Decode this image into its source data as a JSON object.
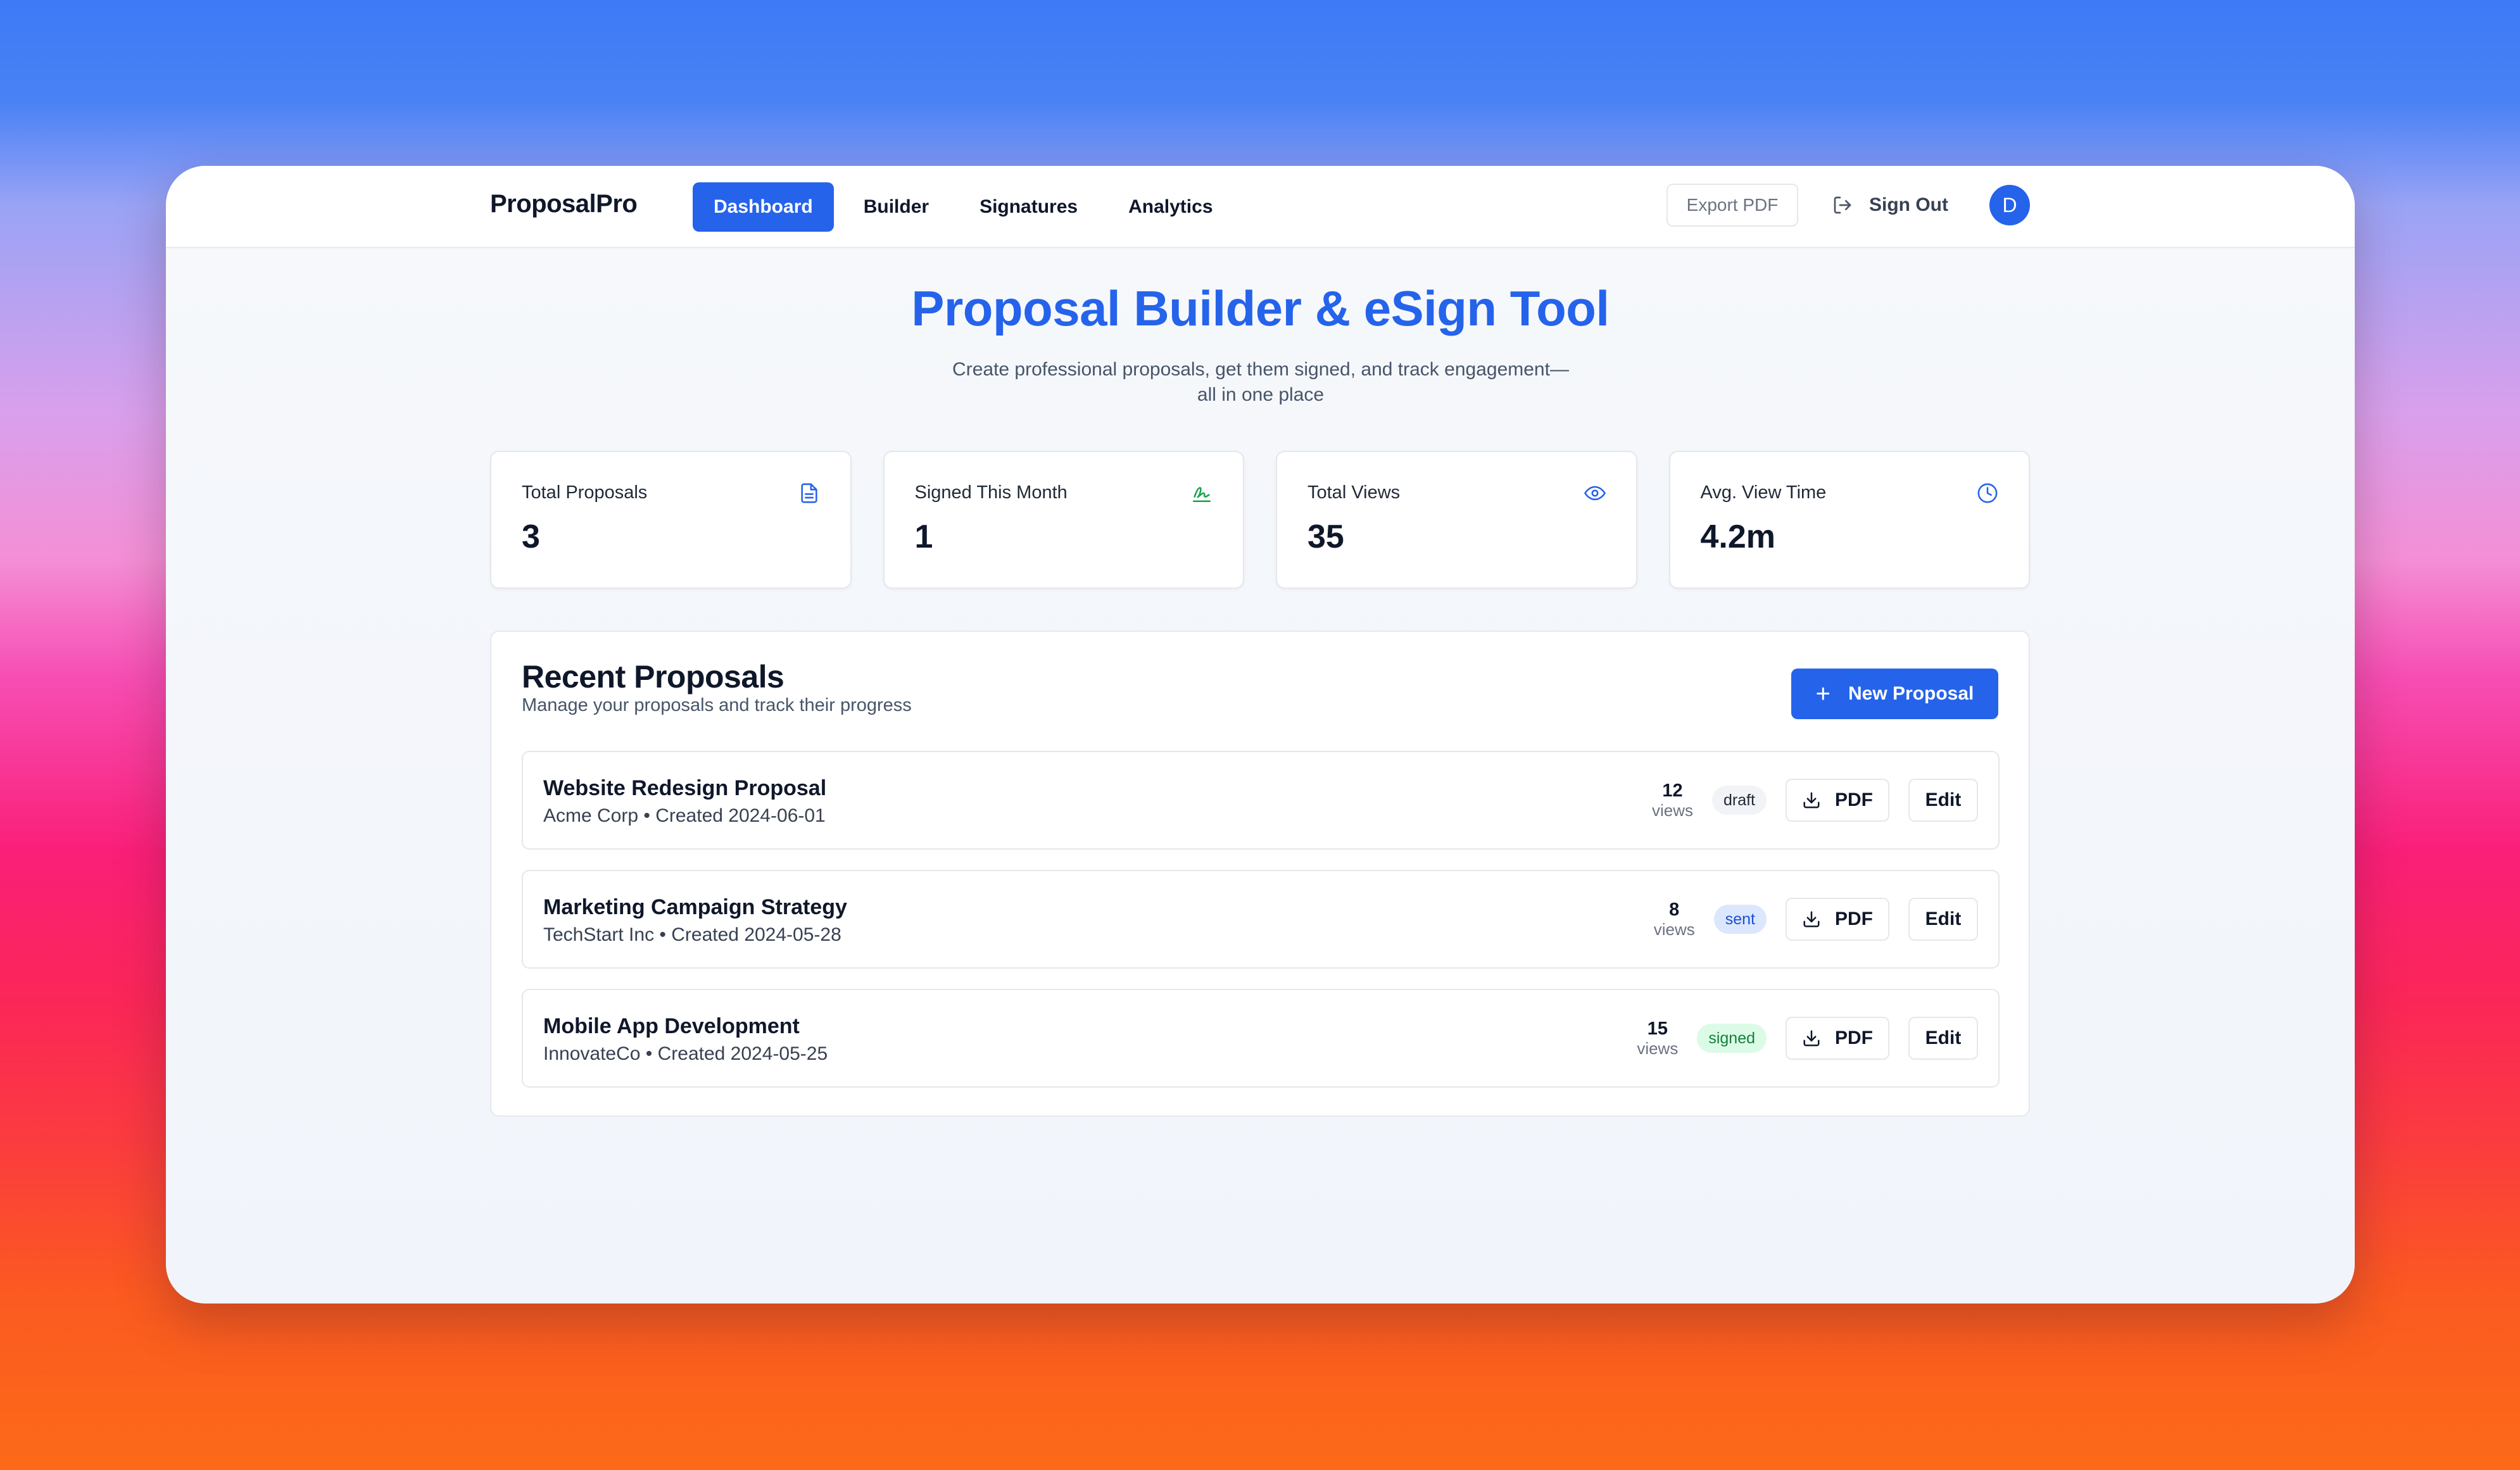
{
  "app": {
    "brand": "ProposalPro"
  },
  "nav": {
    "tabs": [
      {
        "label": "Dashboard",
        "active": true
      },
      {
        "label": "Builder",
        "active": false
      },
      {
        "label": "Signatures",
        "active": false
      },
      {
        "label": "Analytics",
        "active": false
      }
    ]
  },
  "header_actions": {
    "export_label": "Export PDF",
    "signout_label": "Sign Out",
    "signout_icon": "logout-icon",
    "avatar_initial": "D"
  },
  "hero": {
    "title": "Proposal Builder & eSign Tool",
    "subtitle": "Create professional proposals, get them signed, and track engagement—all in one place"
  },
  "stats": [
    {
      "label": "Total Proposals",
      "value": "3",
      "icon": "document-icon",
      "icon_color": "#2563eb"
    },
    {
      "label": "Signed This Month",
      "value": "1",
      "icon": "signature-icon",
      "icon_color": "#16a34a"
    },
    {
      "label": "Total Views",
      "value": "35",
      "icon": "eye-icon",
      "icon_color": "#2563eb"
    },
    {
      "label": "Avg. View Time",
      "value": "4.2m",
      "icon": "clock-icon",
      "icon_color": "#2563eb"
    }
  ],
  "recent": {
    "title": "Recent Proposals",
    "subtitle": "Manage your proposals and track their progress",
    "new_button_label": "New Proposal",
    "views_label": "views",
    "pdf_label": "PDF",
    "edit_label": "Edit",
    "items": [
      {
        "name": "Website Redesign Proposal",
        "meta": "Acme Corp • Created 2024-06-01",
        "views": "12",
        "status": "draft"
      },
      {
        "name": "Marketing Campaign Strategy",
        "meta": "TechStart Inc • Created 2024-05-28",
        "views": "8",
        "status": "sent"
      },
      {
        "name": "Mobile App Development",
        "meta": "InnovateCo • Created 2024-05-25",
        "views": "15",
        "status": "signed"
      }
    ]
  },
  "colors": {
    "accent": "#2563eb",
    "text_dark": "#0f172a",
    "signed_green": "#16a34a"
  }
}
